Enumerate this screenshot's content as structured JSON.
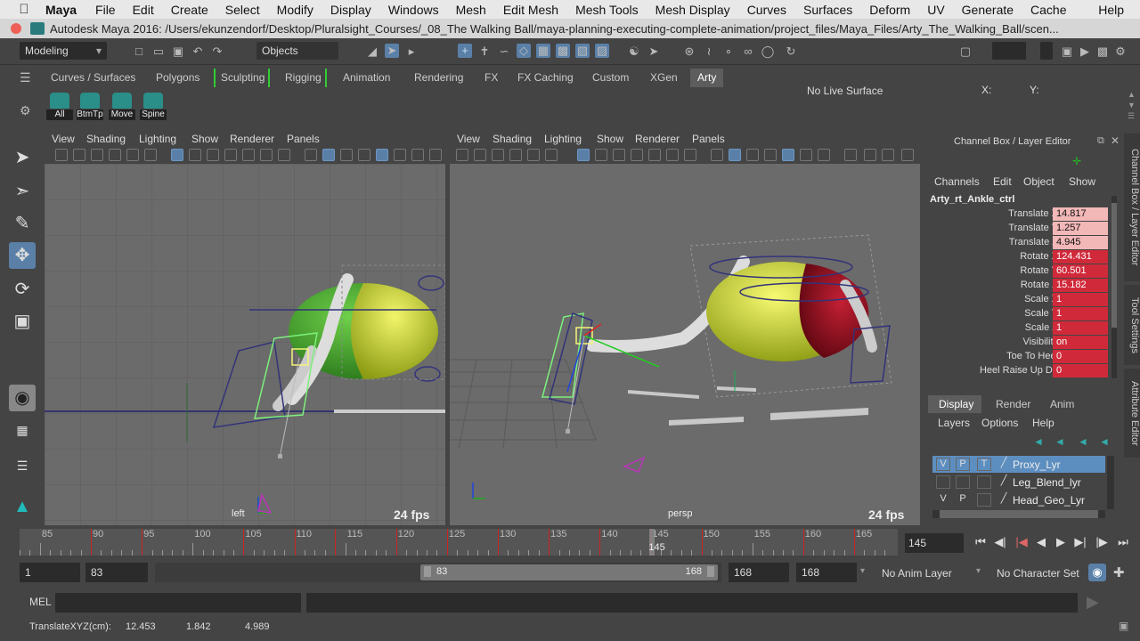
{
  "menubar": {
    "items": [
      "Maya",
      "File",
      "Edit",
      "Create",
      "Select",
      "Modify",
      "Display",
      "Windows",
      "Mesh",
      "Edit Mesh",
      "Mesh Tools",
      "Mesh Display",
      "Curves",
      "Surfaces",
      "Deform",
      "UV",
      "Generate",
      "Cache",
      "Help"
    ]
  },
  "window": {
    "title": "Autodesk Maya 2016: /Users/ekunzendorf/Desktop/Pluralsight_Courses/_08_The Walking Ball/maya-planning-executing-complete-animation/project_files/Maya_Files/Arty_The_Walking_Ball/scen..."
  },
  "statusline": {
    "mode": "Modeling",
    "selection_mask": "Objects",
    "live_surface": "No Live Surface",
    "x_label": "X:",
    "y_label": "Y:"
  },
  "shelf": {
    "tabs": [
      "Curves / Surfaces",
      "Polygons",
      "Sculpting",
      "Rigging",
      "Animation",
      "Rendering",
      "FX",
      "FX Caching",
      "Custom",
      "XGen",
      "Arty"
    ],
    "active_tab": "Arty",
    "buttons": [
      "All",
      "BtmTp",
      "Move",
      "Spine"
    ]
  },
  "viewport_left": {
    "menu": [
      "View",
      "Shading",
      "Lighting",
      "Show",
      "Renderer",
      "Panels"
    ],
    "camera": "left",
    "fps": "24 fps"
  },
  "viewport_right": {
    "menu": [
      "View",
      "Shading",
      "Lighting",
      "Show",
      "Renderer",
      "Panels"
    ],
    "camera": "persp",
    "fps": "24 fps"
  },
  "channelbox": {
    "title": "Channel Box / Layer Editor",
    "menu": [
      "Channels",
      "Edit",
      "Object",
      "Show"
    ],
    "object": "Arty_rt_Ankle_ctrl",
    "channels": [
      {
        "label": "Translate X",
        "value": "14.817",
        "color": "pink"
      },
      {
        "label": "Translate Y",
        "value": "1.257",
        "color": "pink"
      },
      {
        "label": "Translate Z",
        "value": "4.945",
        "color": "pink"
      },
      {
        "label": "Rotate X",
        "value": "124.431",
        "color": "red"
      },
      {
        "label": "Rotate Y",
        "value": "60.501",
        "color": "red"
      },
      {
        "label": "Rotate Z",
        "value": "15.182",
        "color": "red"
      },
      {
        "label": "Scale X",
        "value": "1",
        "color": "red"
      },
      {
        "label": "Scale Y",
        "value": "1",
        "color": "red"
      },
      {
        "label": "Scale Z",
        "value": "1",
        "color": "red"
      },
      {
        "label": "Visibility",
        "value": "on",
        "color": "red"
      },
      {
        "label": "Toe To Heel",
        "value": "0",
        "color": "red"
      },
      {
        "label": "Heel Raise Up Dn",
        "value": "0",
        "color": "red"
      }
    ],
    "side_tabs": [
      "Channel Box / Layer Editor",
      "Tool Settings",
      "Attribute Editor"
    ]
  },
  "layereditor": {
    "tabs": [
      "Display",
      "Render",
      "Anim"
    ],
    "active_tab": "Display",
    "menu": [
      "Layers",
      "Options",
      "Help"
    ],
    "layers": [
      {
        "name": "Proxy_Lyr",
        "v": "V",
        "p": "P",
        "t": "T",
        "selected": true
      },
      {
        "name": "Leg_Blend_lyr",
        "v": "",
        "p": "",
        "t": "",
        "selected": false
      },
      {
        "name": "Head_Geo_Lyr",
        "v": "V",
        "p": "P",
        "t": "",
        "selected": false
      }
    ]
  },
  "timeline": {
    "start": 83,
    "end": 168,
    "labels": [
      "85",
      "90",
      "95",
      "100",
      "105",
      "110",
      "115",
      "120",
      "125",
      "130",
      "135",
      "140",
      "145",
      "150",
      "155",
      "160",
      "165"
    ],
    "current_frame": "145",
    "current_frame_field": "145",
    "keys": [
      90,
      95,
      105,
      110,
      114,
      120,
      125,
      130,
      135,
      140,
      145,
      150,
      160,
      165
    ]
  },
  "rangebar": {
    "start_time": "1",
    "playback_start": "83",
    "slider_start": "83",
    "slider_end": "168",
    "playback_end": "168",
    "end_time": "168",
    "anim_layer": "No Anim Layer",
    "character_set": "No Character Set"
  },
  "cmdline": {
    "label": "MEL"
  },
  "helpline": {
    "label": "TranslateXYZ(cm):",
    "x": "12.453",
    "y": "1.842",
    "z": "4.989"
  },
  "colors": {
    "accent": "#5d8ec0",
    "key_red": "#c22222",
    "ball_yellow": "#c9d21e",
    "ball_green": "#3f9a2c",
    "ball_red": "#9a1020"
  }
}
